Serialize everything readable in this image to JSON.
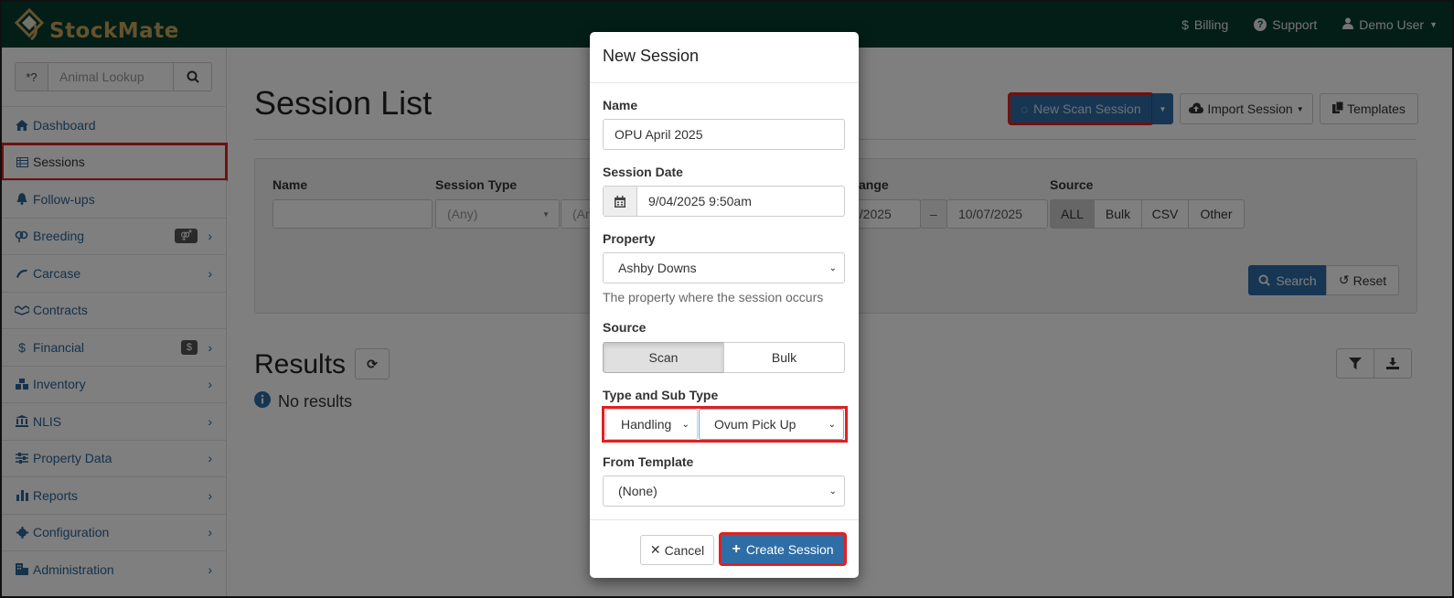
{
  "app": {
    "brand": "StockMate",
    "top_nav": [
      "Billing",
      "Support",
      "Demo User"
    ],
    "colors": {
      "topbar": "#063d2e",
      "brand": "#c9a45c",
      "link": "#2a6496",
      "primary": "#2f6da6",
      "highlight": "#e02020"
    }
  },
  "sidebar": {
    "search_prefix": "*?",
    "search_placeholder": "Animal Lookup",
    "items": [
      {
        "label": "Dashboard",
        "icon": "home-icon"
      },
      {
        "label": "Sessions",
        "icon": "table-icon"
      },
      {
        "label": "Follow-ups",
        "icon": "bell-icon"
      },
      {
        "label": "Breeding",
        "icon": "venus-mars-icon"
      },
      {
        "label": "Carcase",
        "icon": "bacon-icon"
      },
      {
        "label": "Contracts",
        "icon": "handshake-icon"
      },
      {
        "label": "Financial",
        "icon": "dollar-icon",
        "badge": "$"
      },
      {
        "label": "Inventory",
        "icon": "cubes-icon"
      },
      {
        "label": "NLIS",
        "icon": "institution-icon"
      },
      {
        "label": "Property Data",
        "icon": "sliders-icon"
      },
      {
        "label": "Reports",
        "icon": "bar-chart-icon"
      },
      {
        "label": "Configuration",
        "icon": "cog-icon"
      },
      {
        "label": "Administration",
        "icon": "building-icon"
      }
    ]
  },
  "main": {
    "title": "Session List",
    "new_scan_label": "New Scan Session",
    "import_label": "Import Session",
    "templates_label": "Templates",
    "filters": {
      "name_label": "Name",
      "session_type_label": "Session Type",
      "session_type_value": "(Any)",
      "subtype_value": "(An",
      "date_range_label": "ange",
      "date_from": "6/2025",
      "date_sep": "–",
      "date_to": "10/07/2025",
      "source_label": "Source",
      "source_options": [
        "ALL",
        "Bulk",
        "CSV",
        "Other"
      ],
      "search_label": "Search",
      "reset_label": "Reset"
    },
    "results_title": "Results",
    "no_results": "No results"
  },
  "modal": {
    "title": "New Session",
    "name_label": "Name",
    "name_value": "OPU April 2025",
    "date_label": "Session Date",
    "date_value": "9/04/2025 9:50am",
    "property_label": "Property",
    "property_value": "Ashby Downs",
    "property_help": "The property where the session occurs",
    "source_label": "Source",
    "source_options": [
      "Scan",
      "Bulk"
    ],
    "type_label": "Type and Sub Type",
    "type_value": "Handling",
    "subtype_value": "Ovum Pick Up",
    "template_label": "From Template",
    "template_value": "(None)",
    "cancel_label": "Cancel",
    "create_label": "Create Session"
  }
}
